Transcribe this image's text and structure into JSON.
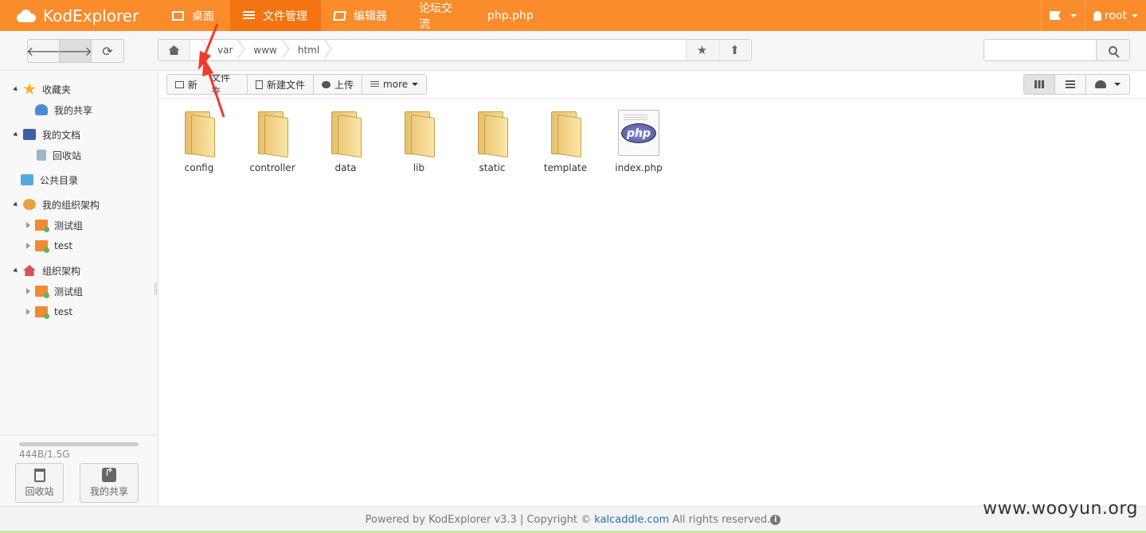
{
  "brand": {
    "name": "KodExplorer"
  },
  "nav": [
    {
      "label": "桌面",
      "icon": "monitor-icon",
      "active": false
    },
    {
      "label": "文件管理",
      "icon": "list-icon",
      "active": true
    },
    {
      "label": "编辑器",
      "icon": "edit-icon",
      "active": false
    },
    {
      "label": "论坛交流",
      "icon": "",
      "active": false
    },
    {
      "label": "php.php",
      "icon": "",
      "active": false
    }
  ],
  "topright": {
    "user": "root"
  },
  "breadcrumb": [
    "",
    "var",
    "www",
    "html"
  ],
  "search": {
    "placeholder": ""
  },
  "sidebar": {
    "items": [
      {
        "label": "收藏夹",
        "icon": "star-icon"
      },
      {
        "label": "我的共享",
        "icon": "share-icon"
      },
      {
        "label": "我的文档",
        "icon": "documents-icon"
      },
      {
        "label": "回收站",
        "icon": "recycle-bin-icon"
      },
      {
        "label": "公共目录",
        "icon": "public-folder-icon"
      },
      {
        "label": "我的组织架构",
        "icon": "group-icon"
      },
      {
        "label": "测试组",
        "icon": "group-folder-icon"
      },
      {
        "label": "test",
        "icon": "group-folder-icon"
      },
      {
        "label": "组织架构",
        "icon": "house-icon"
      },
      {
        "label": "测试组",
        "icon": "group-folder-icon"
      },
      {
        "label": "test",
        "icon": "group-folder-icon"
      }
    ],
    "quota": "444B/1.5G",
    "recycle_label": "回收站",
    "share_label": "我的共享"
  },
  "actions": {
    "new_folder": "新建文件夹",
    "new_folder_shown_left": "新",
    "new_folder_shown_right": "文件夹",
    "new_file": "新建文件",
    "upload": "上传",
    "more": "more"
  },
  "files": [
    {
      "name": "config",
      "type": "folder"
    },
    {
      "name": "controller",
      "type": "folder"
    },
    {
      "name": "data",
      "type": "folder"
    },
    {
      "name": "lib",
      "type": "folder"
    },
    {
      "name": "static",
      "type": "folder"
    },
    {
      "name": "template",
      "type": "folder"
    },
    {
      "name": "index.php",
      "type": "php"
    }
  ],
  "php_badge": "php",
  "footer": {
    "powered": "Powered by KodExplorer v3.3 | Copyright ©",
    "link": "kalcaddle.com",
    "rights": "All rights reserved."
  },
  "watermark": "www.wooyun.org",
  "colors": {
    "accent": "#fb8c2c",
    "accent_active": "#f57412",
    "annotation_arrow": "#f03a2e"
  }
}
